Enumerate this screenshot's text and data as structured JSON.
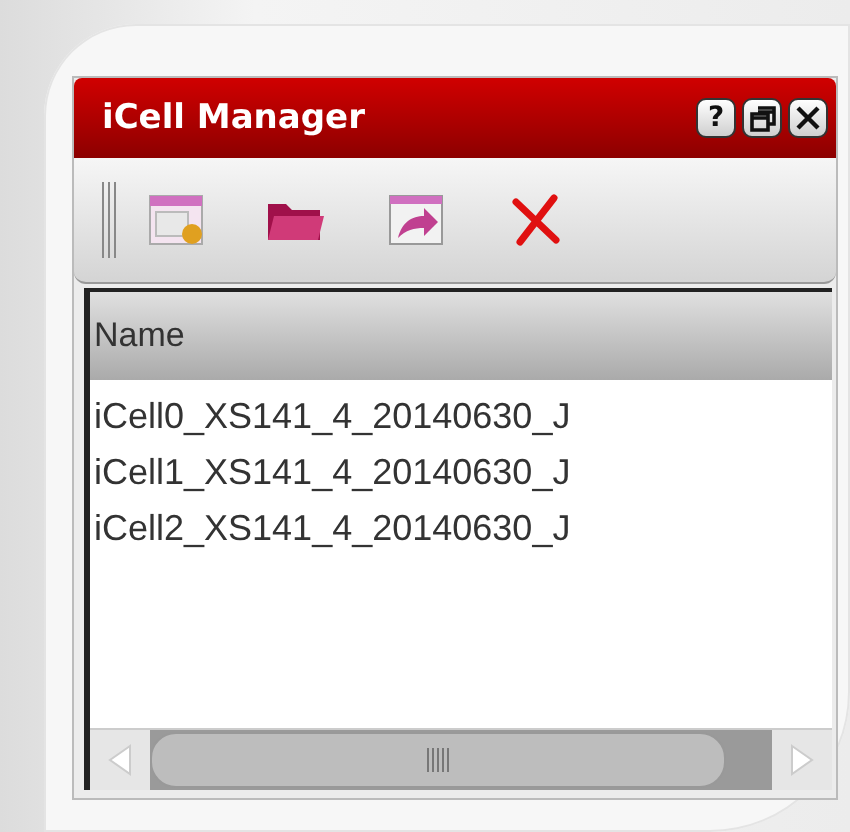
{
  "window": {
    "title": "iCell Manager",
    "title_buttons": [
      "?"
    ]
  },
  "toolbar": {
    "tools": [
      {
        "kind": "new"
      },
      {
        "kind": "open"
      },
      {
        "kind": "export"
      },
      {
        "kind": "delete"
      }
    ]
  },
  "list": {
    "columns": [
      "Name"
    ],
    "rows": [
      {
        "name": "iCell0_XS141_4_20140630_J"
      },
      {
        "name": "iCell1_XS141_4_20140630_J"
      },
      {
        "name": "iCell2_XS141_4_20140630_J"
      }
    ]
  }
}
